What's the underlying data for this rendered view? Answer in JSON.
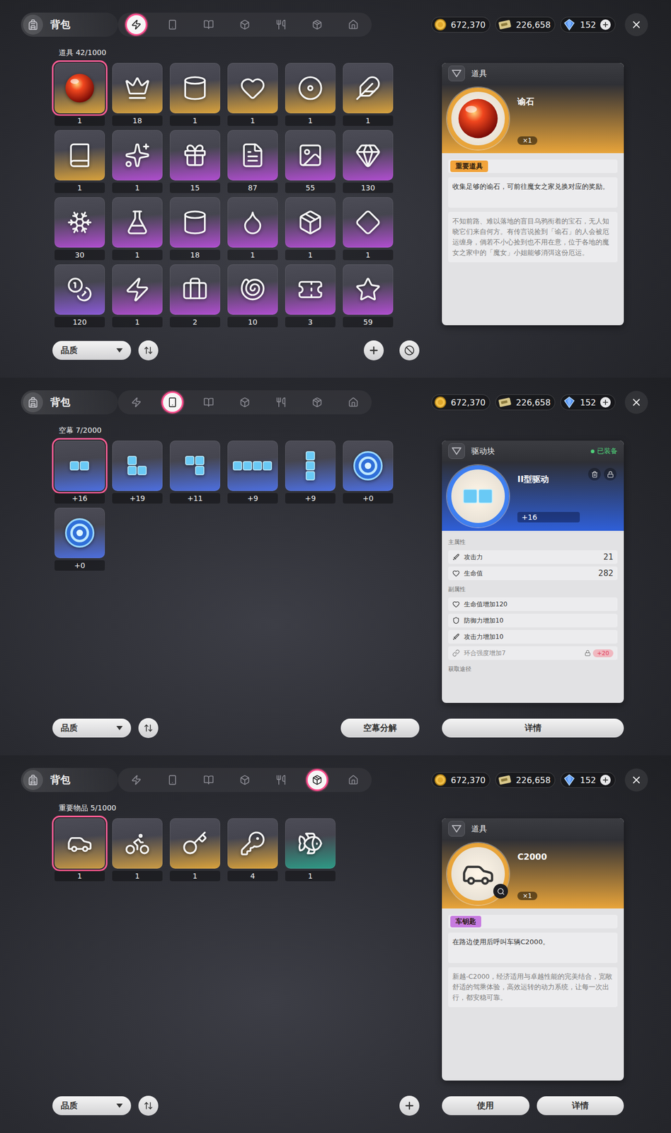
{
  "screens": [
    {
      "title": "背包",
      "tabs": [
        {
          "selected": true
        },
        {
          "selected": false
        },
        {
          "selected": false
        },
        {
          "selected": false
        },
        {
          "selected": false
        },
        {
          "selected": false
        },
        {
          "selected": false
        }
      ],
      "currencies": [
        {
          "kind": "coin",
          "value": "672,370",
          "addable": false
        },
        {
          "kind": "ticket",
          "value": "226,658",
          "addable": false
        },
        {
          "kind": "gem",
          "value": "152",
          "addable": true
        }
      ],
      "inventory": {
        "label": "道具 42/1000",
        "items": [
          {
            "kind": "orb",
            "count": "1",
            "color": "#d9a23c",
            "selected": true
          },
          {
            "kind": "prop",
            "count": "18",
            "color": "#d9a23c",
            "selected": false
          },
          {
            "kind": "prop",
            "count": "1",
            "color": "#d9a23c",
            "selected": false
          },
          {
            "kind": "prop",
            "count": "1",
            "color": "#d9a23c",
            "selected": false
          },
          {
            "kind": "prop",
            "count": "1",
            "color": "#d9a23c",
            "selected": false
          },
          {
            "kind": "prop",
            "count": "1",
            "color": "#d9a23c",
            "selected": false
          },
          {
            "kind": "prop",
            "count": "1",
            "color": "#d9a23c",
            "selected": false
          },
          {
            "kind": "prop",
            "count": "1",
            "color": "#b04ed0",
            "selected": false
          },
          {
            "kind": "prop",
            "count": "15",
            "color": "#b04ed0",
            "selected": false
          },
          {
            "kind": "prop",
            "count": "87",
            "color": "#b04ed0",
            "selected": false
          },
          {
            "kind": "prop",
            "count": "55",
            "color": "#b04ed0",
            "selected": false
          },
          {
            "kind": "prop",
            "count": "130",
            "color": "#b04ed0",
            "selected": false
          },
          {
            "kind": "prop",
            "count": "30",
            "color": "#b04ed0",
            "selected": false
          },
          {
            "kind": "prop",
            "count": "1",
            "color": "#b04ed0",
            "selected": false
          },
          {
            "kind": "prop",
            "count": "18",
            "color": "#b04ed0",
            "selected": false
          },
          {
            "kind": "prop",
            "count": "1",
            "color": "#b04ed0",
            "selected": false
          },
          {
            "kind": "prop",
            "count": "1",
            "color": "#b04ed0",
            "selected": false
          },
          {
            "kind": "prop",
            "count": "1",
            "color": "#b04ed0",
            "selected": false
          },
          {
            "kind": "prop",
            "count": "120",
            "color": "#8a5ad6",
            "selected": false
          },
          {
            "kind": "prop",
            "count": "1",
            "color": "#b04ed0",
            "selected": false
          },
          {
            "kind": "prop",
            "count": "2",
            "color": "#b04ed0",
            "selected": false
          },
          {
            "kind": "prop",
            "count": "10",
            "color": "#b04ed0",
            "selected": false
          },
          {
            "kind": "prop",
            "count": "3",
            "color": "#b04ed0",
            "selected": false
          },
          {
            "kind": "prop",
            "count": "59",
            "color": "#b04ed0",
            "selected": false
          }
        ]
      },
      "detail": {
        "kind": "item",
        "header": "道具",
        "name": "谕石",
        "quantity": "×1",
        "color": "#e8a43a",
        "zoomable": false,
        "tag": "重要道具",
        "tag_color": "#f2a33a",
        "description": "收集足够的谕石，可前往魔女之家兑换对应的奖励。",
        "lore": "不知前路、难以落地的盲目乌鸦衔着的宝石，无人知晓它们来自何方。有传言说捡到「谕石」的人会被厄运缠身，倘若不小心捡到也不用在意，位于各地的魔女之家中的「魔女」小姐能够消弭这份厄运。",
        "buttons": []
      },
      "footer": {
        "sort": "品质",
        "actions": [
          {
            "kind": "add",
            "label": ""
          },
          {
            "kind": "hide",
            "label": ""
          }
        ]
      }
    },
    {
      "title": "背包",
      "tabs": [
        {
          "selected": false
        },
        {
          "selected": true
        },
        {
          "selected": false
        },
        {
          "selected": false
        },
        {
          "selected": false
        },
        {
          "selected": false
        },
        {
          "selected": false
        }
      ],
      "currencies": [
        {
          "kind": "coin",
          "value": "672,370",
          "addable": false
        },
        {
          "kind": "ticket",
          "value": "226,658",
          "addable": false
        },
        {
          "kind": "gem",
          "value": "152",
          "addable": true
        }
      ],
      "inventory": {
        "label": "空幕 7/2000",
        "items": [
          {
            "kind": "block",
            "count": "+16",
            "color": "#4d6fe0",
            "selected": true
          },
          {
            "kind": "block",
            "count": "+19",
            "color": "#4d6fe0",
            "selected": false
          },
          {
            "kind": "block",
            "count": "+11",
            "color": "#4d6fe0",
            "selected": false
          },
          {
            "kind": "block",
            "count": "+9",
            "color": "#4d6fe0",
            "selected": false
          },
          {
            "kind": "block",
            "count": "+9",
            "color": "#4d6fe0",
            "selected": false
          },
          {
            "kind": "disc",
            "count": "+0",
            "color": "#4d6fe0",
            "selected": false
          },
          {
            "kind": "disc",
            "count": "+0",
            "color": "#4d6fe0",
            "selected": false
          }
        ]
      },
      "detail": {
        "kind": "drive",
        "header": "驱动块",
        "status": "已装备",
        "name": "II型驱动",
        "level": "+16",
        "color": "#2f5fd8",
        "main_title": "主属性",
        "main_stats": [
          {
            "kind": "atk",
            "name": "攻击力",
            "value": "21"
          },
          {
            "kind": "hp",
            "name": "生命值",
            "value": "282"
          }
        ],
        "sub_title": "副属性",
        "sub_stats": [
          {
            "kind": "hp",
            "name": "生命值增加120",
            "locked": false,
            "bonus": ""
          },
          {
            "kind": "def",
            "name": "防御力增加10",
            "locked": false,
            "bonus": ""
          },
          {
            "kind": "atk",
            "name": "攻击力增加10",
            "locked": false,
            "bonus": ""
          },
          {
            "kind": "link",
            "name": "环合强度增加7",
            "locked": true,
            "bonus": "+20"
          }
        ],
        "source_title": "获取途径",
        "buttons": [
          "详情"
        ]
      },
      "footer": {
        "sort": "品质",
        "actions": [
          {
            "kind": "text",
            "label": "空幕分解"
          }
        ]
      }
    },
    {
      "title": "背包",
      "tabs": [
        {
          "selected": false
        },
        {
          "selected": false
        },
        {
          "selected": false
        },
        {
          "selected": false
        },
        {
          "selected": false
        },
        {
          "selected": true
        },
        {
          "selected": false
        }
      ],
      "currencies": [
        {
          "kind": "coin",
          "value": "672,370",
          "addable": false
        },
        {
          "kind": "ticket",
          "value": "226,658",
          "addable": false
        },
        {
          "kind": "gem",
          "value": "152",
          "addable": true
        }
      ],
      "inventory": {
        "label": "重要物品 5/1000",
        "items": [
          {
            "kind": "car",
            "count": "1",
            "color": "#c99a45",
            "selected": true
          },
          {
            "kind": "scooter",
            "count": "1",
            "color": "#c99a45",
            "selected": false
          },
          {
            "kind": "key",
            "count": "1",
            "color": "#d9a23c",
            "selected": false
          },
          {
            "kind": "goldkey",
            "count": "4",
            "color": "#d9a23c",
            "selected": false
          },
          {
            "kind": "rod",
            "count": "1",
            "color": "#2e9a86",
            "selected": false
          }
        ]
      },
      "detail": {
        "kind": "item",
        "header": "道具",
        "name": "C2000",
        "quantity": "×1",
        "color": "#e8a43a",
        "zoomable": true,
        "tag": "车钥匙",
        "tag_color": "#c77be0",
        "description": "在路边使用后呼叫车辆C2000。",
        "lore": "新越-C2000，经济适用与卓越性能的完美结合，宽敞舒适的驾乘体验，高效运转的动力系统，让每一次出行，都安稳可靠。",
        "buttons": [
          "使用",
          "详情"
        ]
      },
      "footer": {
        "sort": "品质",
        "actions": [
          {
            "kind": "add",
            "label": ""
          }
        ]
      }
    }
  ]
}
